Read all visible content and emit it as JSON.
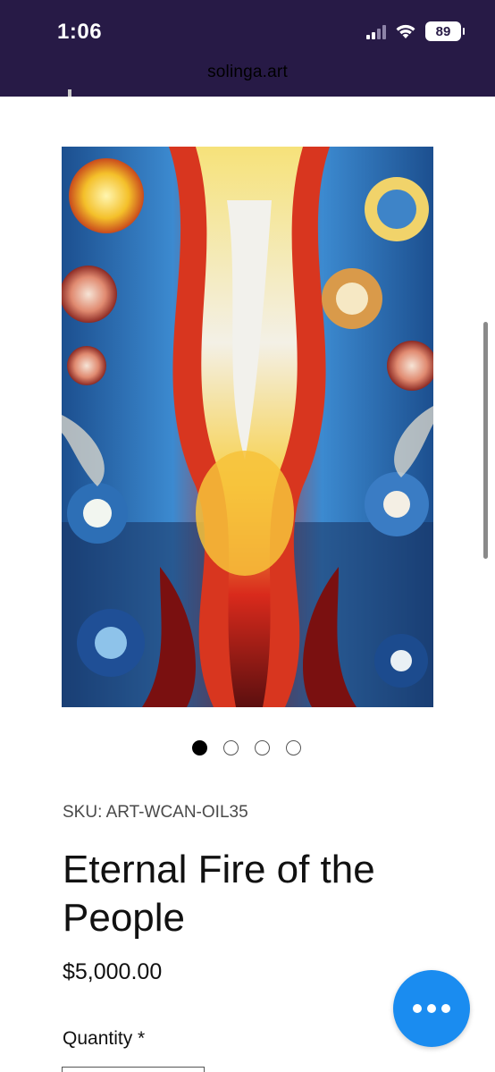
{
  "status_bar": {
    "time": "1:06",
    "battery": "89"
  },
  "browser": {
    "url": "solinga.art"
  },
  "product": {
    "image_alt": "Eternal Fire of the People painting",
    "carousel_count": 4,
    "carousel_active": 0,
    "sku": "SKU: ART-WCAN-OIL35",
    "title": "Eternal Fire of the People",
    "price": "$5,000.00",
    "quantity_label": "Quantity *"
  },
  "colors": {
    "status_bar_bg": "#271a46",
    "fab_bg": "#1a8cf0"
  },
  "icons": {
    "fab": "more-horizontal-icon"
  }
}
